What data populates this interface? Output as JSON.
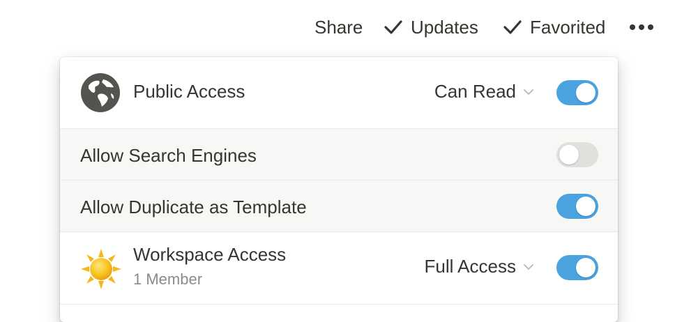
{
  "topbar": {
    "share_label": "Share",
    "updates_label": "Updates",
    "favorited_label": "Favorited",
    "more_icon": "more-horizontal-icon"
  },
  "sharing_panel": {
    "public_access": {
      "icon": "globe-icon",
      "label": "Public Access",
      "permission": "Can Read",
      "enabled": true
    },
    "allow_search_engines": {
      "label": "Allow Search Engines",
      "enabled": false
    },
    "allow_duplicate_template": {
      "label": "Allow Duplicate as Template",
      "enabled": true
    },
    "workspace_access": {
      "icon": "sun-icon",
      "label": "Workspace Access",
      "members": "1 Member",
      "permission": "Full Access",
      "enabled": true
    }
  },
  "colors": {
    "toggle_on": "#4aa3df",
    "toggle_off": "#e0e0dd",
    "text": "#37352f",
    "muted_text": "#8c8b87",
    "row_gray": "#f7f7f5"
  }
}
